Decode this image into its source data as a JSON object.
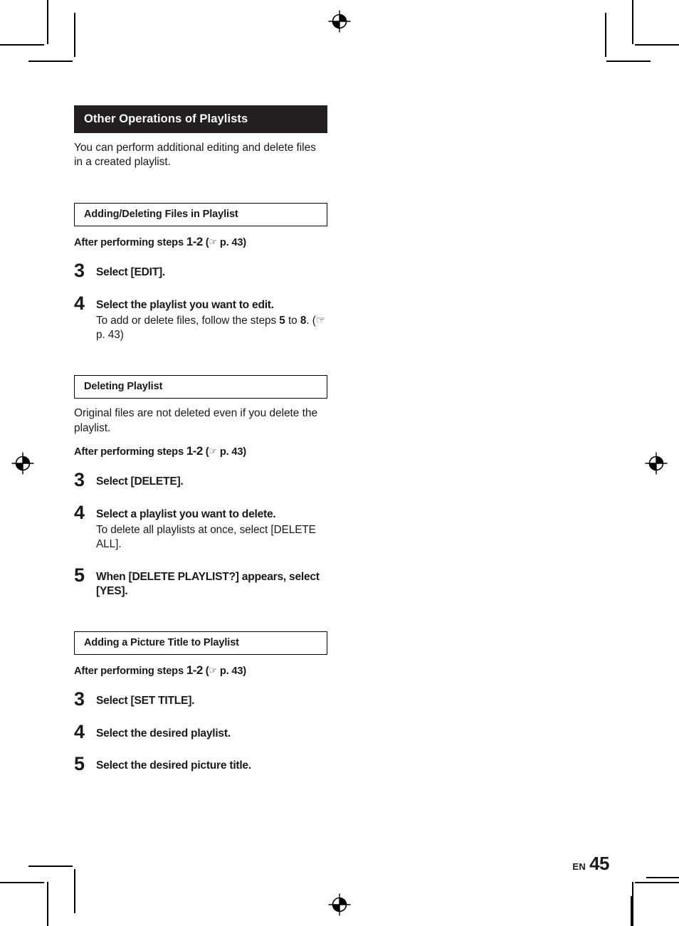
{
  "page": {
    "footer_locale": "EN",
    "footer_number": "45"
  },
  "section": {
    "bar_title": "Other Operations of Playlists",
    "intro": "You can perform additional editing and delete files in a created playlist."
  },
  "blocks": [
    {
      "heading": "Adding/Deleting Files in Playlist",
      "note": null,
      "after_prefix": "After performing steps",
      "after_range": "1-2",
      "after_ref_open": "(",
      "after_hand_icon": "pointing-hand-icon",
      "after_page": "p. 43",
      "after_ref_close": ")",
      "steps": [
        {
          "num": "3",
          "title": "Select [EDIT].",
          "sub": null
        },
        {
          "num": "4",
          "title": "Select the playlist you want to edit.",
          "sub": "To add or delete files, follow the steps 5 to 8. (☞ p. 43)",
          "sub_parts": [
            {
              "t": "To add or delete files, follow the steps ",
              "b": false
            },
            {
              "t": "5",
              "b": true
            },
            {
              "t": " to ",
              "b": false
            },
            {
              "t": "8",
              "b": true
            },
            {
              "t": ". (☞ p. 43)",
              "b": false
            }
          ]
        }
      ]
    },
    {
      "heading": "Deleting Playlist",
      "note": "Original files are not deleted even if you delete the playlist.",
      "after_prefix": "After performing steps",
      "after_range": "1-2",
      "after_ref_open": "(",
      "after_hand_icon": "pointing-hand-icon",
      "after_page": "p. 43",
      "after_ref_close": ")",
      "steps": [
        {
          "num": "3",
          "title": "Select [DELETE].",
          "sub": null
        },
        {
          "num": "4",
          "title": "Select a playlist you want to delete.",
          "sub": "To delete all playlists at once, select [DELETE ALL]."
        },
        {
          "num": "5",
          "title": "When [DELETE PLAYLIST?] appears, select [YES].",
          "sub": null
        }
      ]
    },
    {
      "heading": "Adding a Picture Title to Playlist",
      "note": null,
      "after_prefix": "After performing steps",
      "after_range": "1-2",
      "after_ref_open": "(",
      "after_hand_icon": "pointing-hand-icon",
      "after_page": "p. 43",
      "after_ref_close": ")",
      "steps": [
        {
          "num": "3",
          "title": "Select [SET TITLE].",
          "sub": null
        },
        {
          "num": "4",
          "title": "Select the desired playlist.",
          "sub": null
        },
        {
          "num": "5",
          "title": "Select the desired picture title.",
          "sub": null
        }
      ]
    }
  ],
  "print_marks": {
    "registration_icon": "registration-target-icon",
    "crop_mark_icon": "crop-mark-icon"
  }
}
